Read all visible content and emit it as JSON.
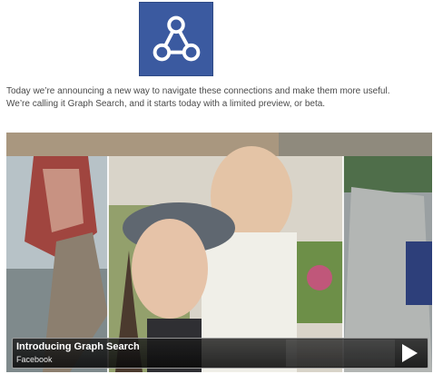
{
  "icon": {
    "name": "graph-search-icon",
    "color": "#3b5aa0"
  },
  "intro": {
    "line1": "Today we’re announcing a new way to navigate these connections and make them more useful.",
    "line2": "We’re calling it Graph Search, and it starts today with a limited preview, or beta."
  },
  "video": {
    "title": "Introducing Graph Search",
    "channel": "Facebook",
    "play_icon": "play-icon"
  }
}
